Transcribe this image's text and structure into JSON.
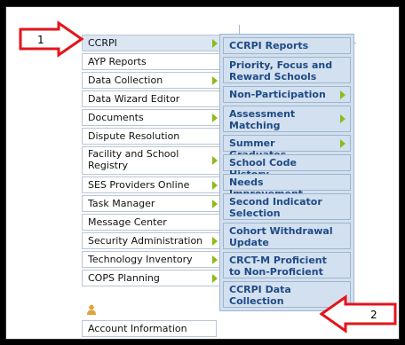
{
  "main_menu": [
    {
      "label": "CCRPI",
      "arrow": true,
      "selected": true
    },
    {
      "label": "AYP Reports",
      "arrow": false
    },
    {
      "label": "Data Collection",
      "arrow": true
    },
    {
      "label": "Data Wizard Editor",
      "arrow": false
    },
    {
      "label": "Documents",
      "arrow": true
    },
    {
      "label": "Dispute Resolution",
      "arrow": false
    },
    {
      "label": "Facility and School Registry",
      "arrow": true
    },
    {
      "label": "SES Providers Online",
      "arrow": true
    },
    {
      "label": "Task Manager",
      "arrow": true
    },
    {
      "label": "Message Center",
      "arrow": false
    },
    {
      "label": "Security Administration",
      "arrow": true
    },
    {
      "label": "Technology Inventory",
      "arrow": true
    },
    {
      "label": "COPS Planning",
      "arrow": true
    }
  ],
  "submenu": [
    {
      "label": "CCRPI Reports",
      "arrow": false
    },
    {
      "label": "Priority, Focus and Reward Schools",
      "arrow": false
    },
    {
      "label": "Non-Participation",
      "arrow": true
    },
    {
      "label": "Assessment Matching",
      "arrow": true
    },
    {
      "label": "Summer Graduates",
      "arrow": true
    },
    {
      "label": "School Code History",
      "arrow": false
    },
    {
      "label": "Needs Improvement",
      "arrow": false
    },
    {
      "label": "Second Indicator Selection",
      "arrow": false
    },
    {
      "label": "Cohort Withdrawal Update",
      "arrow": false
    },
    {
      "label": "CRCT-M Proficient to Non-Proficient",
      "arrow": false
    },
    {
      "label": "CCRPI Data Collection",
      "arrow": false
    }
  ],
  "account": {
    "label": "Account Information"
  },
  "callouts": {
    "first": "1",
    "second": "2"
  },
  "colors": {
    "arrow_green": "#8dbb1a",
    "submenu_bg": "#d2e0ef",
    "submenu_text": "#1f4a86",
    "callout_red": "#e3151a"
  }
}
